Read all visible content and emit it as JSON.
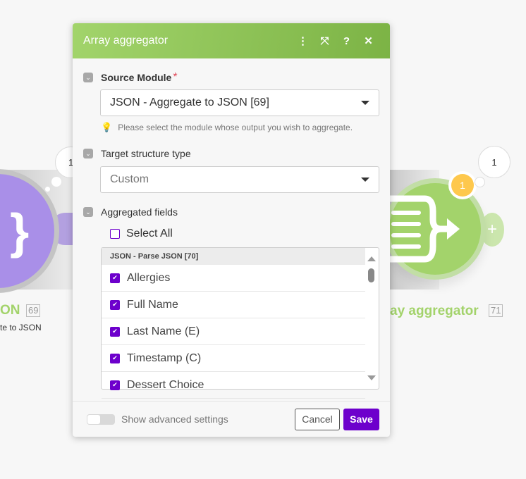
{
  "canvas": {
    "left_module": {
      "title_partial": "ON",
      "id": "69",
      "subtitle_partial": "te to JSON",
      "bubble_count": "1",
      "color": "#a98fe8"
    },
    "right_module": {
      "title_partial": "ay aggregator",
      "id": "71",
      "bubble_count": "1",
      "badge_count": "1",
      "color": "#a3d36b",
      "add_label": "+"
    }
  },
  "dialog": {
    "title": "Array aggregator",
    "header_icons": [
      "more-vertical-icon",
      "expand-icon",
      "help-icon",
      "close-icon"
    ],
    "source_module": {
      "label": "Source Module",
      "required_mark": "*",
      "value": "JSON - Aggregate to JSON [69]",
      "hint": "Please select the module whose output you wish to aggregate."
    },
    "target_structure": {
      "label": "Target structure type",
      "value": "Custom"
    },
    "aggregated_fields": {
      "label": "Aggregated fields",
      "select_all": "Select All",
      "select_all_checked": false,
      "group_header": "JSON - Parse JSON [70]",
      "items": [
        {
          "label": "Allergies",
          "checked": true
        },
        {
          "label": "Full Name",
          "checked": true
        },
        {
          "label": "Last Name (E)",
          "checked": true
        },
        {
          "label": "Timestamp (C)",
          "checked": true
        },
        {
          "label": "Dessert Choice",
          "checked": true
        }
      ]
    },
    "footer": {
      "advanced_label": "Show advanced settings",
      "advanced_on": false,
      "cancel": "Cancel",
      "save": "Save"
    },
    "colors": {
      "accent": "#6d00cc",
      "header": "#8cc152"
    }
  }
}
